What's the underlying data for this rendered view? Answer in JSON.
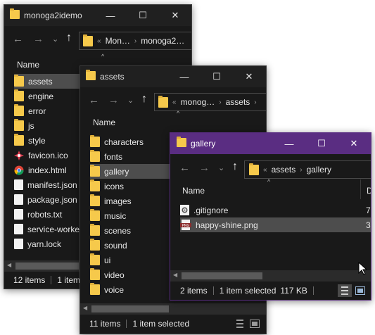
{
  "win1": {
    "title": "monoga2idemo",
    "controls": {
      "minimize": "—",
      "maximize": "☐",
      "close": "✕"
    },
    "nav": {
      "back": "←",
      "forward": "→",
      "recent": "⌄",
      "up": "↑"
    },
    "address": {
      "overflow": "«",
      "crumbs": [
        "Mon…",
        "monoga2…"
      ]
    },
    "column_header": "Name",
    "items": [
      {
        "label": "assets",
        "icon": "folder-icon",
        "selected": true
      },
      {
        "label": "engine",
        "icon": "folder-icon"
      },
      {
        "label": "error",
        "icon": "folder-icon"
      },
      {
        "label": "js",
        "icon": "folder-icon"
      },
      {
        "label": "style",
        "icon": "folder-icon"
      },
      {
        "label": "favicon.ico",
        "icon": "favicon-icon"
      },
      {
        "label": "index.html",
        "icon": "chrome-icon"
      },
      {
        "label": "manifest.json",
        "icon": "file-icon"
      },
      {
        "label": "package.json",
        "icon": "file-icon"
      },
      {
        "label": "robots.txt",
        "icon": "file-icon"
      },
      {
        "label": "service-worker",
        "icon": "file-icon"
      },
      {
        "label": "yarn.lock",
        "icon": "file-icon"
      }
    ],
    "status": {
      "count": "12 items",
      "selection": "1 item"
    }
  },
  "win2": {
    "title": "assets",
    "controls": {
      "minimize": "—",
      "maximize": "☐",
      "close": "✕"
    },
    "nav": {
      "back": "←",
      "forward": "→",
      "recent": "⌄",
      "up": "↑"
    },
    "address": {
      "overflow": "«",
      "crumbs": [
        "monog…",
        "assets"
      ]
    },
    "column_header": "Name",
    "items": [
      {
        "label": "characters"
      },
      {
        "label": "fonts"
      },
      {
        "label": "gallery",
        "selected": true
      },
      {
        "label": "icons"
      },
      {
        "label": "images"
      },
      {
        "label": "music"
      },
      {
        "label": "scenes"
      },
      {
        "label": "sound"
      },
      {
        "label": "ui"
      },
      {
        "label": "video"
      },
      {
        "label": "voice"
      }
    ],
    "status": {
      "count": "11 items",
      "selection": "1 item selected"
    }
  },
  "win3": {
    "title": "gallery",
    "controls": {
      "minimize": "—",
      "maximize": "☐",
      "close": "✕"
    },
    "nav": {
      "back": "←",
      "forward": "→",
      "recent": "⌄",
      "up": "↑"
    },
    "address": {
      "overflow": "«",
      "crumbs": [
        "assets",
        "gallery"
      ]
    },
    "column_header": "Name",
    "column_header_2": "D",
    "items": [
      {
        "label": ".gitignore",
        "icon": "gear-file-icon",
        "extra": "7"
      },
      {
        "label": "happy-shine.png",
        "icon": "png-icon",
        "extra": "3",
        "selected": true
      }
    ],
    "status": {
      "count": "2 items",
      "selection": "1 item selected",
      "size": "117 KB"
    },
    "accent": "#5a2d82"
  },
  "colors": {
    "folder": "#f6c94b",
    "window_bg": "#191919",
    "selection": "#4d4d4d"
  }
}
